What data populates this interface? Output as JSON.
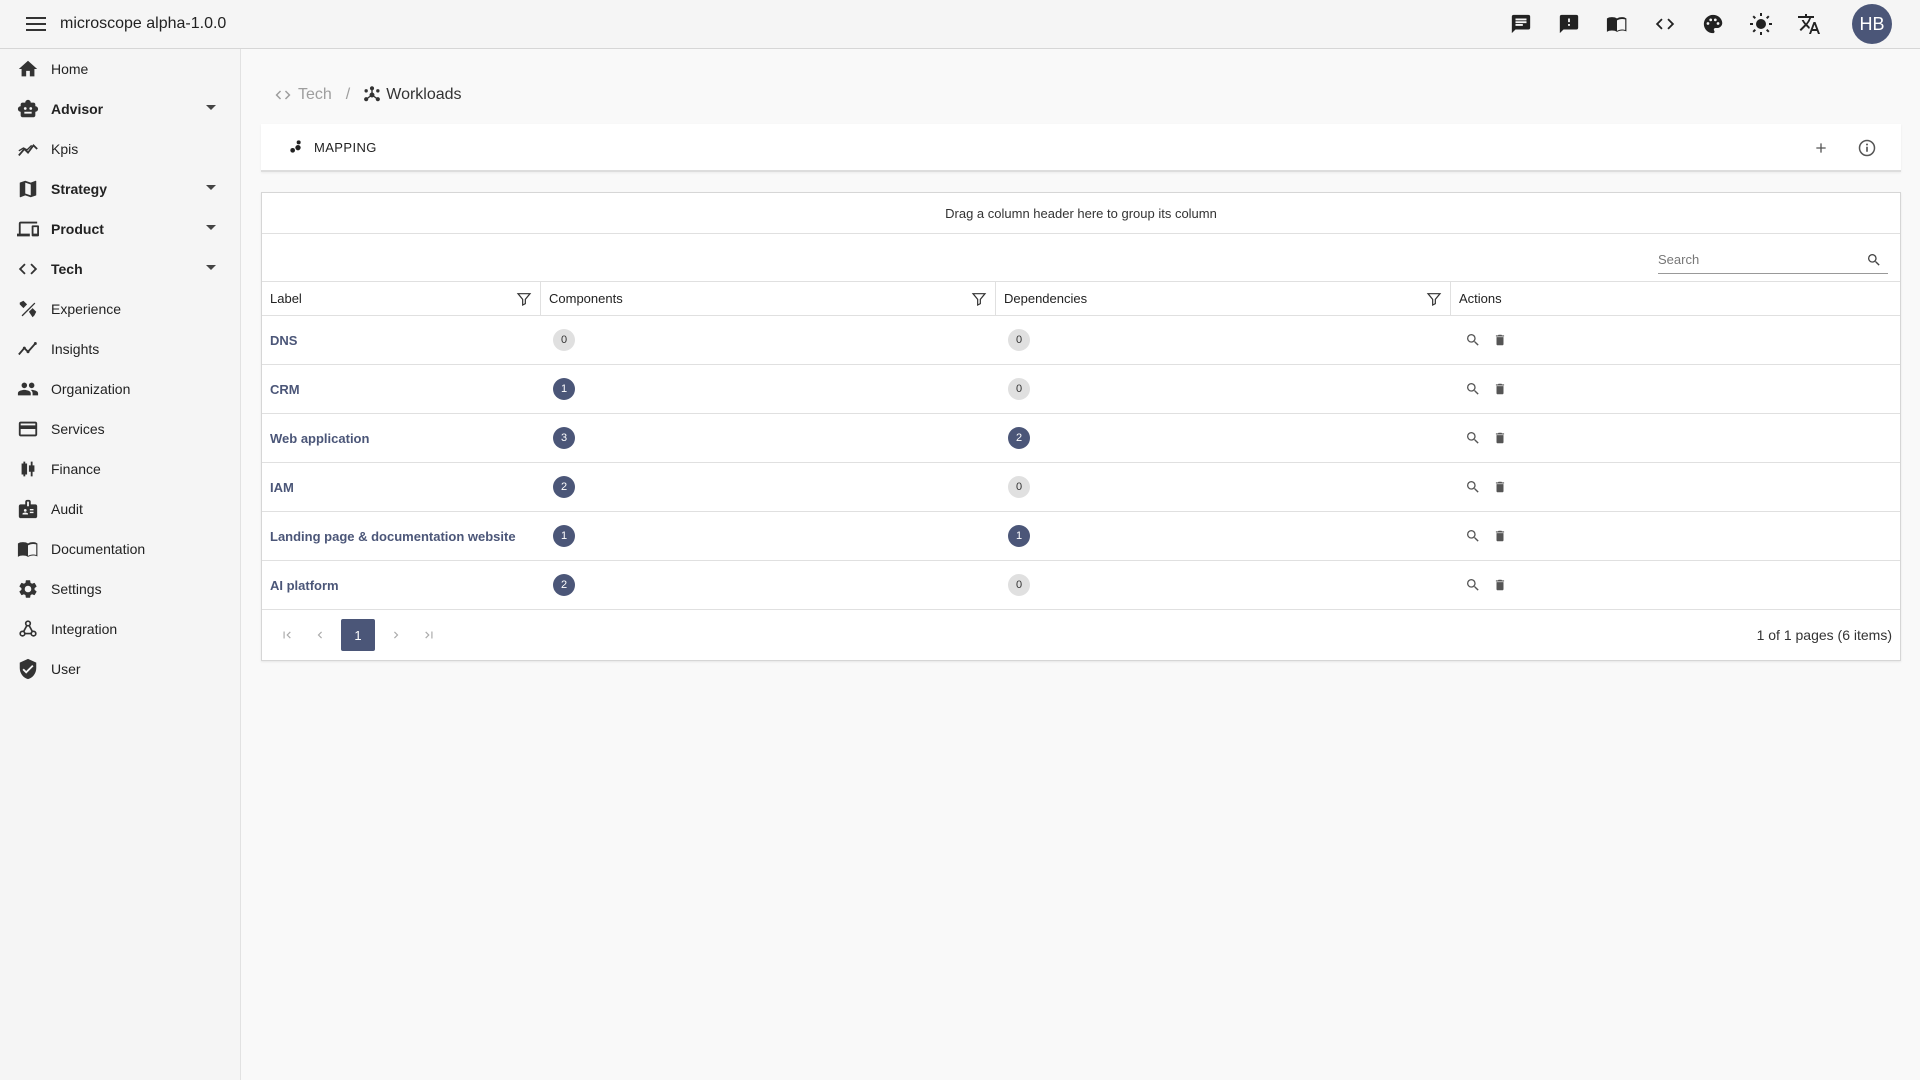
{
  "app": {
    "title": "microscope  alpha-1.0.0",
    "avatar_initials": "HB"
  },
  "topbar_icons": [
    "chat-icon",
    "feedback-icon",
    "book-icon",
    "code-icon",
    "palette-icon",
    "theme-brightness-icon",
    "translate-icon"
  ],
  "sidebar": {
    "items": [
      {
        "label": "Home",
        "icon": "home-icon",
        "expandable": false,
        "bold": false
      },
      {
        "label": "Advisor",
        "icon": "robot-icon",
        "expandable": true,
        "bold": true
      },
      {
        "label": "Kpis",
        "icon": "chart-line-icon",
        "expandable": false,
        "bold": false
      },
      {
        "label": "Strategy",
        "icon": "map-icon",
        "expandable": true,
        "bold": true
      },
      {
        "label": "Product",
        "icon": "devices-icon",
        "expandable": true,
        "bold": true
      },
      {
        "label": "Tech",
        "icon": "code-icon",
        "expandable": true,
        "bold": true
      },
      {
        "label": "Experience",
        "icon": "design-tools-icon",
        "expandable": false,
        "bold": false
      },
      {
        "label": "Insights",
        "icon": "insights-icon",
        "expandable": false,
        "bold": false
      },
      {
        "label": "Organization",
        "icon": "people-icon",
        "expandable": false,
        "bold": false
      },
      {
        "label": "Services",
        "icon": "card-icon",
        "expandable": false,
        "bold": false
      },
      {
        "label": "Finance",
        "icon": "candlestick-icon",
        "expandable": false,
        "bold": false
      },
      {
        "label": "Audit",
        "icon": "audit-icon",
        "expandable": false,
        "bold": false
      },
      {
        "label": "Documentation",
        "icon": "book-icon",
        "expandable": false,
        "bold": false
      },
      {
        "label": "Settings",
        "icon": "gear-icon",
        "expandable": false,
        "bold": false
      },
      {
        "label": "Integration",
        "icon": "webhook-icon",
        "expandable": false,
        "bold": false
      },
      {
        "label": "User",
        "icon": "shield-check-icon",
        "expandable": false,
        "bold": false
      }
    ]
  },
  "breadcrumb": {
    "parent": "Tech",
    "current": "Workloads"
  },
  "tabs": [
    {
      "label": "MAPPING",
      "icon": "scatter-icon"
    }
  ],
  "grid": {
    "group_panel_text": "Drag a column header here to group its column",
    "search_placeholder": "Search",
    "columns": [
      "Label",
      "Components",
      "Dependencies",
      "Actions"
    ],
    "rows": [
      {
        "label": "DNS",
        "components": "0",
        "dependencies": "0"
      },
      {
        "label": "CRM",
        "components": "1",
        "dependencies": "0"
      },
      {
        "label": "Web application",
        "components": "3",
        "dependencies": "2"
      },
      {
        "label": "IAM",
        "components": "2",
        "dependencies": "0"
      },
      {
        "label": "Landing page & documentation website",
        "components": "1",
        "dependencies": "1"
      },
      {
        "label": "AI platform",
        "components": "2",
        "dependencies": "0"
      }
    ],
    "pager": {
      "current_page": "1",
      "info": "1 of 1 pages (6 items)"
    }
  },
  "colors": {
    "accent": "#4b5678",
    "badge_zero": "#e0e0e0"
  }
}
